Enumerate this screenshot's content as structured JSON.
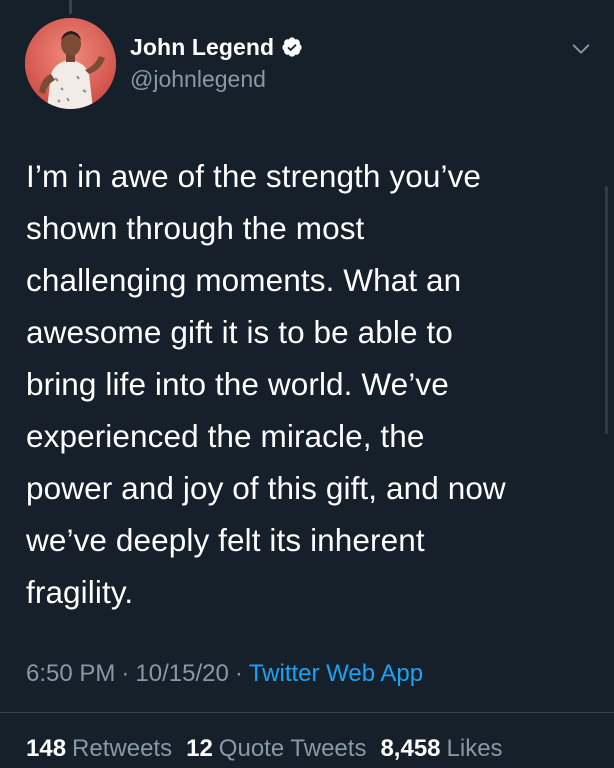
{
  "tweet": {
    "author": {
      "display_name": "John Legend",
      "handle": "@johnlegend",
      "verified": true,
      "avatar_icon": "profile-photo"
    },
    "text": "I’m in awe of the strength you’ve\nshown through the most\nchallenging moments. What an\nawesome gift it is to be able to\nbring life into the world.  We’ve\nexperienced the miracle, the\npower and joy of this gift, and now\nwe’ve deeply felt its inherent\nfragility.",
    "time": "6:50 PM",
    "date": "10/15/20",
    "separator": "·",
    "source": "Twitter Web App",
    "stats": {
      "retweets_count": "148",
      "retweets_label": "Retweets",
      "quote_tweets_count": "12",
      "quote_tweets_label": "Quote Tweets",
      "likes_count": "8,458",
      "likes_label": "Likes"
    }
  },
  "colors": {
    "background": "#15202b",
    "text_primary": "#ffffff",
    "text_secondary": "#8899a6",
    "link": "#1da1f2",
    "divider": "#38444d"
  }
}
